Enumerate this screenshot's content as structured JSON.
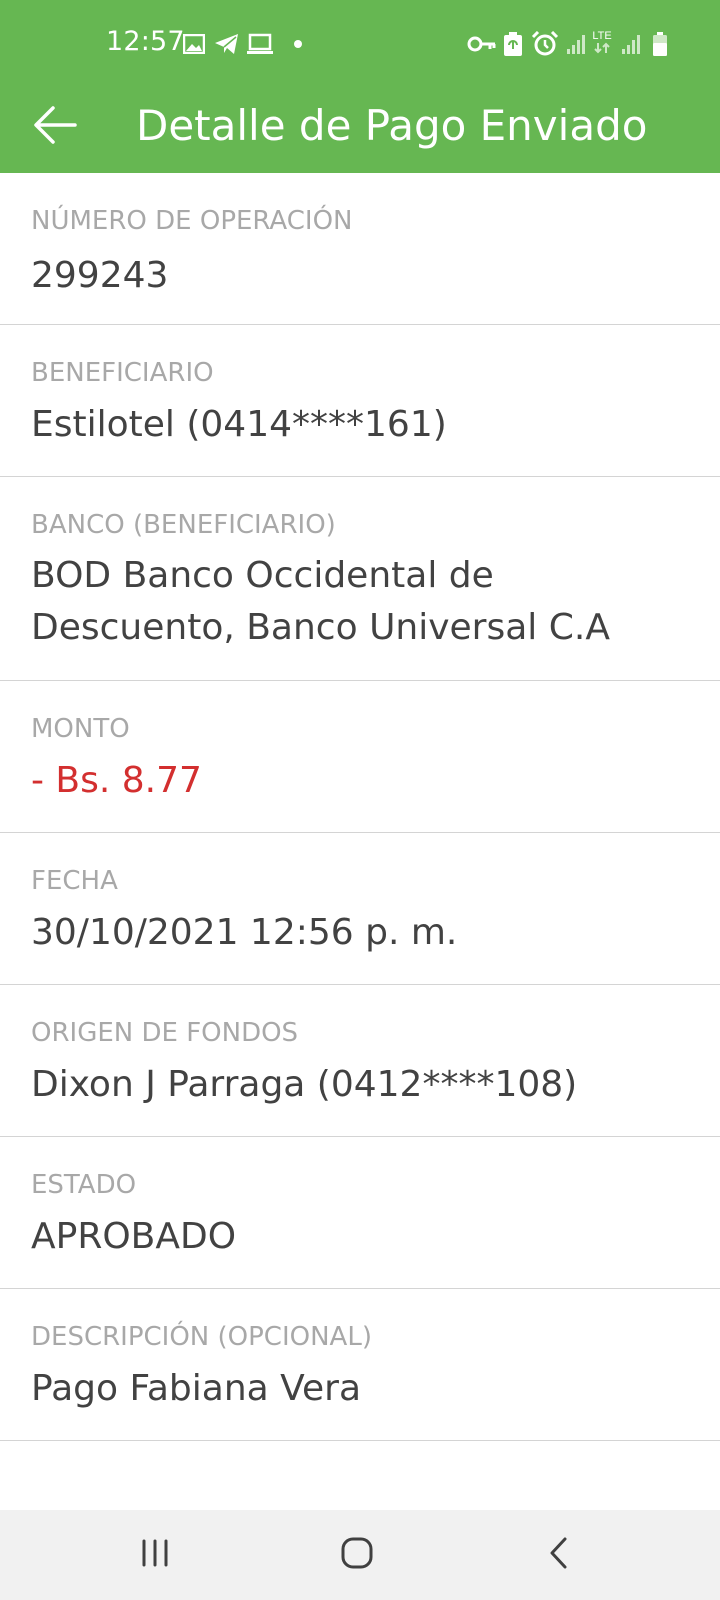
{
  "status_bar": {
    "time": "12:57",
    "icons": [
      "image-icon",
      "telegram-icon",
      "laptop-icon",
      "dot-icon",
      "vpn-key-icon",
      "battery-saver-icon",
      "alarm-icon",
      "signal-icon",
      "lte-icon",
      "signal-icon",
      "battery-icon"
    ],
    "lte_label": "LTE"
  },
  "toolbar": {
    "title": "Detalle de Pago Enviado",
    "back_icon": "arrow-back-icon",
    "background_color": "#66b752"
  },
  "details": [
    {
      "label": "NÚMERO DE OPERACIÓN",
      "value": "299243"
    },
    {
      "label": "BENEFICIARIO",
      "value": "Estilotel (0414****161)"
    },
    {
      "label": "BANCO (BENEFICIARIO)",
      "value": "BOD Banco Occidental de Descuento, Banco Universal C.A"
    },
    {
      "label": "MONTO",
      "value": "- Bs. 8.77",
      "value_color": "#d32f2f"
    },
    {
      "label": "FECHA",
      "value": "30/10/2021 12:56 p. m."
    },
    {
      "label": "ORIGEN DE FONDOS",
      "value": "Dixon J Parraga (0412****108)"
    },
    {
      "label": "ESTADO",
      "value": "APROBADO"
    },
    {
      "label": "DESCRIPCIÓN (OPCIONAL)",
      "value": "Pago Fabiana Vera"
    }
  ],
  "nav_bar": {
    "buttons": [
      "recent-apps-icon",
      "home-icon",
      "back-icon"
    ]
  }
}
